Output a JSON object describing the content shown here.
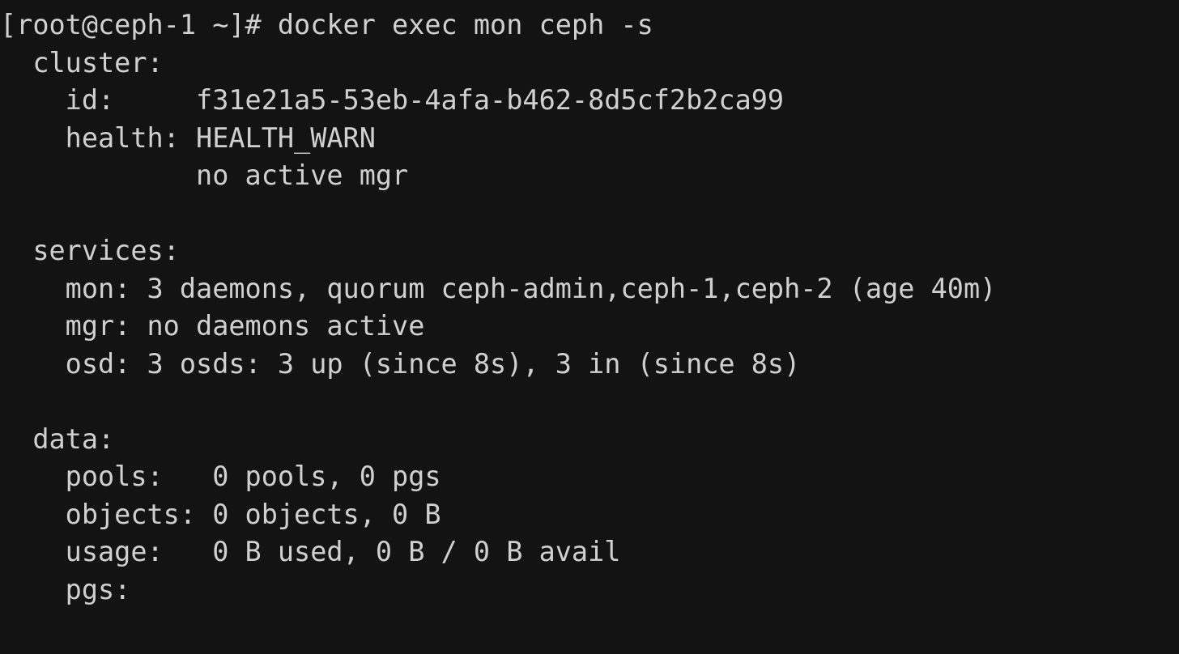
{
  "terminal": {
    "colors": {
      "background": "#131313",
      "foreground": "#d0d0d0"
    },
    "prompt": {
      "user": "root",
      "host": "ceph-1",
      "cwd": "~",
      "symbol": "#",
      "full": "[root@ceph-1 ~]#",
      "command": "docker exec mon ceph -s",
      "full_line": "[root@ceph-1 ~]# docker exec mon ceph -s"
    },
    "output": {
      "cluster": {
        "heading": "  cluster:",
        "id_line": "    id:     f31e21a5-53eb-4afa-b462-8d5cf2b2ca99",
        "id_label": "id:",
        "id_value": "f31e21a5-53eb-4afa-b462-8d5cf2b2ca99",
        "health_line": "    health: HEALTH_WARN",
        "health_label": "health:",
        "health_value": "HEALTH_WARN",
        "health_detail_line": "            no active mgr",
        "health_detail": "no active mgr"
      },
      "services": {
        "heading": "  services:",
        "mon_line": "    mon: 3 daemons, quorum ceph-admin,ceph-1,ceph-2 (age 40m)",
        "mon_label": "mon:",
        "mon_value": "3 daemons, quorum ceph-admin,ceph-1,ceph-2 (age 40m)",
        "mgr_line": "    mgr: no daemons active",
        "mgr_label": "mgr:",
        "mgr_value": "no daemons active",
        "osd_line": "    osd: 3 osds: 3 up (since 8s), 3 in (since 8s)",
        "osd_label": "osd:",
        "osd_value": "3 osds: 3 up (since 8s), 3 in (since 8s)"
      },
      "data": {
        "heading": "  data:",
        "pools_line": "    pools:   0 pools, 0 pgs",
        "pools_label": "pools:",
        "pools_value": "0 pools, 0 pgs",
        "objects_line": "    objects: 0 objects, 0 B",
        "objects_label": "objects:",
        "objects_value": "0 objects, 0 B",
        "usage_line": "    usage:   0 B used, 0 B / 0 B avail",
        "usage_label": "usage:",
        "usage_value": "0 B used, 0 B / 0 B avail",
        "pgs_line": "    pgs:",
        "pgs_label": "pgs:",
        "pgs_value": ""
      },
      "blank": ""
    }
  }
}
